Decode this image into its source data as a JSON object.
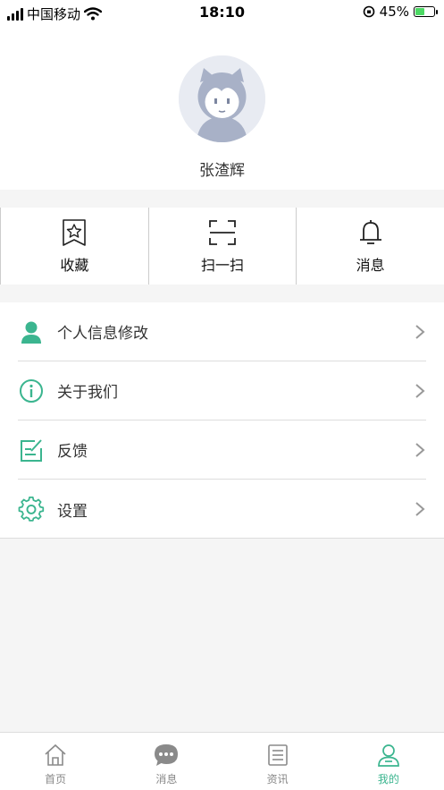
{
  "status_bar": {
    "carrier": "中国移动",
    "time": "18:10",
    "battery": "45%",
    "battery_level": 0.45
  },
  "profile": {
    "username": "张渣辉"
  },
  "quick_actions": [
    {
      "label": "收藏",
      "icon": "star-bookmark-icon"
    },
    {
      "label": "扫一扫",
      "icon": "scan-icon"
    },
    {
      "label": "消息",
      "icon": "bell-icon"
    }
  ],
  "menu": [
    {
      "label": "个人信息修改",
      "icon": "person-icon"
    },
    {
      "label": "关于我们",
      "icon": "info-icon"
    },
    {
      "label": "反馈",
      "icon": "feedback-edit-icon"
    },
    {
      "label": "设置",
      "icon": "gear-icon"
    }
  ],
  "tabs": [
    {
      "label": "首页",
      "icon": "home-icon",
      "active": false
    },
    {
      "label": "消息",
      "icon": "chat-bubble-icon",
      "active": false
    },
    {
      "label": "资讯",
      "icon": "news-list-icon",
      "active": false
    },
    {
      "label": "我的",
      "icon": "user-icon",
      "active": true
    }
  ],
  "colors": {
    "accent": "#3bb58f",
    "icon_gray": "#8a8a8a",
    "background": "#f5f5f5"
  }
}
